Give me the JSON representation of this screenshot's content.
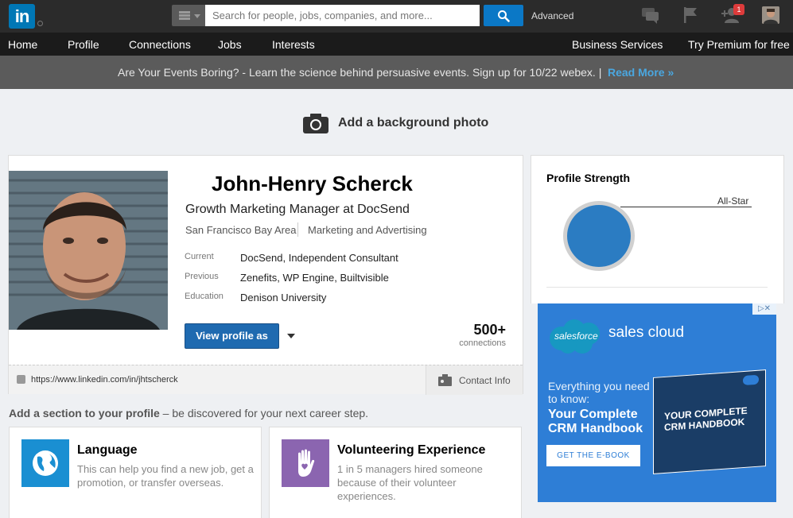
{
  "topbar": {
    "logo_text": "in",
    "search_placeholder": "Search for people, jobs, companies, and more...",
    "advanced_label": "Advanced",
    "notification_count": "1"
  },
  "nav": {
    "items": [
      "Home",
      "Profile",
      "Connections",
      "Jobs",
      "Interests"
    ],
    "right_items": [
      "Business Services",
      "Try Premium for free"
    ]
  },
  "announcement": {
    "text": "Are Your Events Boring? - Learn the science behind persuasive events. Sign up for 10/22 webex. |",
    "link": "Read More »"
  },
  "background_photo": {
    "label": "Add a background photo"
  },
  "profile": {
    "name": "John-Henry Scherck",
    "headline": "Growth Marketing Manager at DocSend",
    "location": "San Francisco Bay Area",
    "industry": "Marketing and Advertising",
    "current_label": "Current",
    "current_value": "DocSend, Independent Consultant",
    "previous_label": "Previous",
    "previous_value": "Zenefits, WP Engine, Builtvisible",
    "education_label": "Education",
    "education_value": "Denison University",
    "view_profile_label": "View profile as",
    "connections_count": "500+",
    "connections_label": "connections",
    "url": "https://www.linkedin.com/in/jhtscherck",
    "contact_label": "Contact Info"
  },
  "add_section": {
    "bold": "Add a section to your profile",
    "rest": " – be discovered for your next career step."
  },
  "cards": [
    {
      "title": "Language",
      "desc": "This can help you find a new job, get a promotion, or transfer overseas.",
      "icon": "globe-icon",
      "color": "#1a8fd2"
    },
    {
      "title": "Volunteering Experience",
      "desc": "1 in 5 managers hired someone because of their volunteer experiences.",
      "icon": "heart-hand-icon",
      "color": "#8b65b0"
    }
  ],
  "strength": {
    "title": "Profile Strength",
    "level": "All-Star"
  },
  "ad": {
    "brand": "salesforce",
    "product": "sales cloud",
    "eyebrow": "Everything you need to know:",
    "headline": "Your Complete CRM Handbook",
    "cta": "GET THE E-BOOK",
    "book_title": "YOUR COMPLETE CRM HANDBOOK",
    "choices": "▷✕"
  },
  "colors": {
    "brand": "#0077b5",
    "primary_button": "#1f6ab0",
    "strength_fill": "#2b7cc2",
    "ad_bg": "#2e7ed6"
  }
}
